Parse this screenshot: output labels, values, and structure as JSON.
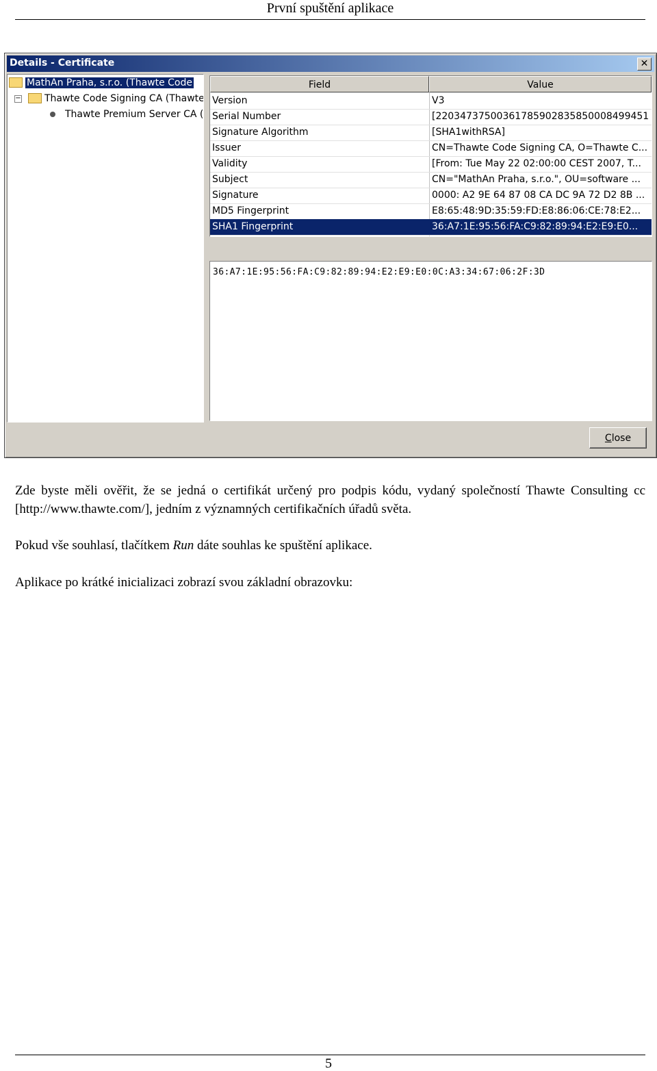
{
  "page": {
    "header": "První spuštění aplikace",
    "page_number": "5"
  },
  "dialog": {
    "title": "Details - Certificate",
    "close_glyph": "✕",
    "tree": [
      "MathAn Praha, s.r.o. (Thawte Code",
      "Thawte Code Signing CA (Thawte",
      "Thawte Premium Server CA ("
    ],
    "columns": {
      "field": "Field",
      "value": "Value"
    },
    "rows": [
      {
        "field": "Version",
        "value": "V3"
      },
      {
        "field": "Serial Number",
        "value": "[22034737500361785902835850008499451..."
      },
      {
        "field": "Signature Algorithm",
        "value": "[SHA1withRSA]"
      },
      {
        "field": "Issuer",
        "value": "CN=Thawte Code Signing CA, O=Thawte C..."
      },
      {
        "field": "Validity",
        "value": "[From: Tue May 22 02:00:00 CEST 2007, T..."
      },
      {
        "field": "Subject",
        "value": "CN=\"MathAn Praha, s.r.o.\", OU=software ..."
      },
      {
        "field": "Signature",
        "value": "0000: A2 9E 64 87 08 CA DC 9A  72 D2 8B ..."
      },
      {
        "field": "MD5 Fingerprint",
        "value": "E8:65:48:9D:35:59:FD:E8:86:06:CE:78:E2..."
      },
      {
        "field": "SHA1 Fingerprint",
        "value": "36:A7:1E:95:56:FA:C9:82:89:94:E2:E9:E0..."
      }
    ],
    "detail_value": "36:A7:1E:95:56:FA:C9:82:89:94:E2:E9:E0:0C:A3:34:67:06:2F:3D",
    "close_button": "Close"
  },
  "text": {
    "p1": "Zde byste měli ověřit, že se jedná o certifikát určený pro podpis kódu, vydaný společností Thawte Consulting cc [http://www.thawte.com/], jedním z významných certifikačních úřadů světa.",
    "p2_before": "Pokud vše souhlasí, tlačítkem ",
    "p2_em": "Run",
    "p2_after": " dáte souhlas ke spuštění aplikace.",
    "p3": "Aplikace po krátké inicializaci zobrazí svou základní obrazovku:"
  }
}
